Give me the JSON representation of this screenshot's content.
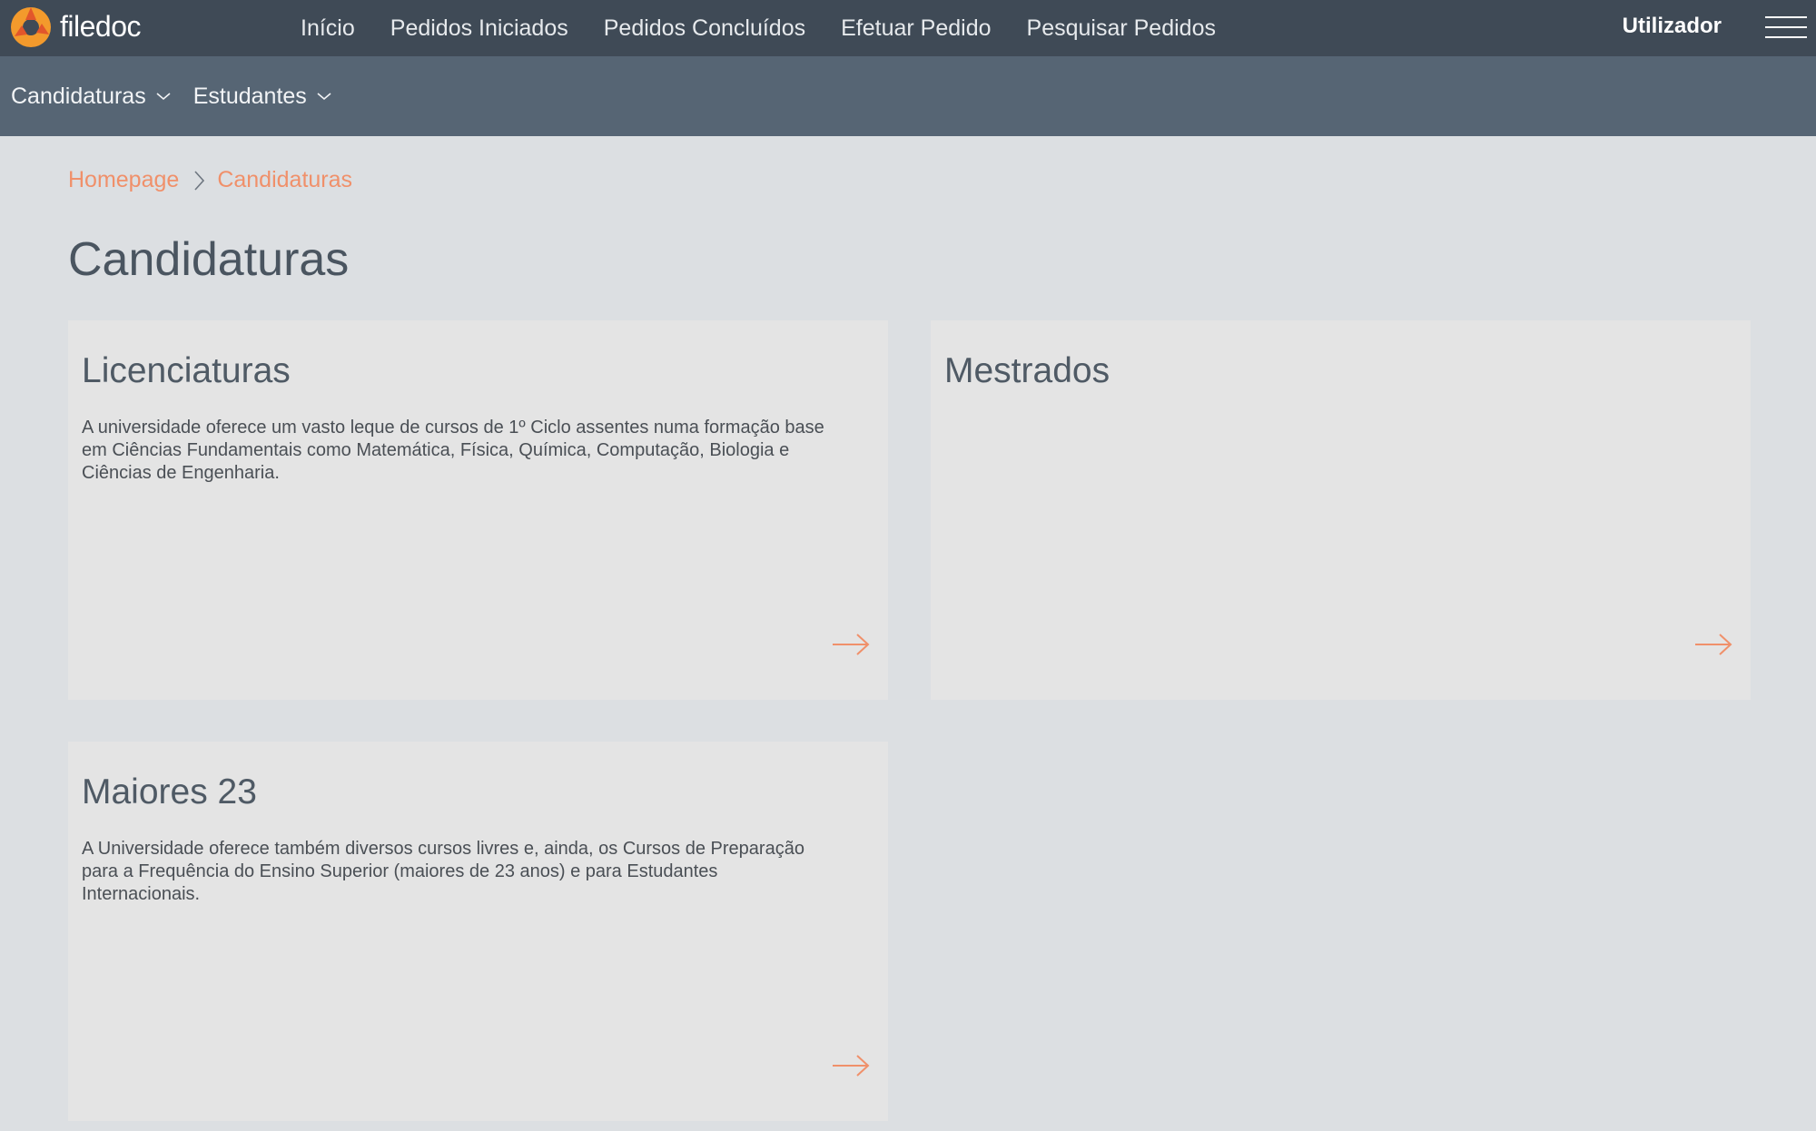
{
  "topbar": {
    "brand": "filedoc",
    "nav": [
      {
        "label": "Início"
      },
      {
        "label": "Pedidos Iniciados"
      },
      {
        "label": "Pedidos Concluídos"
      },
      {
        "label": "Efetuar Pedido"
      },
      {
        "label": "Pesquisar Pedidos"
      }
    ],
    "user_label": "Utilizador",
    "colors": {
      "background": "#3f4a56",
      "logo_orange": "#f39a2c"
    }
  },
  "subbar": {
    "menus": [
      {
        "label": "Candidaturas",
        "icon": "chevron-down-icon"
      },
      {
        "label": "Estudantes",
        "icon": "chevron-down-icon"
      }
    ],
    "colors": {
      "background": "#566574"
    }
  },
  "breadcrumb": {
    "items": [
      {
        "label": "Homepage"
      },
      {
        "label": "Candidaturas"
      }
    ],
    "separator_icon": "chevron-right-icon",
    "color": "#f0906a"
  },
  "page": {
    "title": "Candidaturas"
  },
  "cards": [
    {
      "title": "Licenciaturas",
      "text": "A universidade oferece um vasto leque de cursos de 1º Ciclo assentes numa formação base em Ciências Fundamentais como Matemática, Física, Química, Computação, Biologia e Ciências de Engenharia.",
      "icon": "arrow-right-icon"
    },
    {
      "title": "Mestrados",
      "text": "",
      "icon": "arrow-right-icon"
    },
    {
      "title": "Maiores 23",
      "text": "A Universidade oferece também diversos cursos livres e, ainda, os Cursos de Preparação para a Frequência do Ensino Superior (maiores de 23 anos) e para Estudantes Internacionais.",
      "icon": "arrow-right-icon"
    }
  ]
}
